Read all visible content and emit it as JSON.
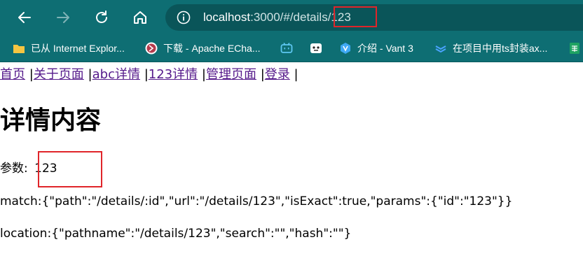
{
  "browser": {
    "url_host": "localhost",
    "url_path": ":3000/#/details/",
    "url_id": "123"
  },
  "bookmarks": [
    {
      "label": "已从 Internet Explor...",
      "icon": "folder-icon"
    },
    {
      "label": "下载 - Apache ECha...",
      "icon": "echarts-icon"
    },
    {
      "label": "",
      "icon": "bilibili-icon"
    },
    {
      "label": "",
      "icon": "game-icon"
    },
    {
      "label": "介绍 - Vant 3",
      "icon": "vant-icon"
    },
    {
      "label": "在项目中用ts封装ax...",
      "icon": "layers-icon"
    },
    {
      "label": "",
      "icon": "sheets-icon"
    }
  ],
  "nav": {
    "home": "首页",
    "about": "关于页面",
    "abc": "abc详情",
    "detail123": "123详情",
    "admin": "管理页面",
    "login": "登录",
    "sep": "|"
  },
  "content": {
    "title": "详情内容",
    "param_label": "参数:",
    "param_value": "123",
    "match_text": "match:{\"path\":\"/details/:id\",\"url\":\"/details/123\",\"isExact\":true,\"params\":{\"id\":\"123\"}}",
    "location_text": "location:{\"pathname\":\"/details/123\",\"search\":\"\",\"hash\":\"\"}"
  },
  "colors": {
    "toolbar": "#0e6e73",
    "link_visited": "#551a8b",
    "highlight": "#e0252a"
  }
}
